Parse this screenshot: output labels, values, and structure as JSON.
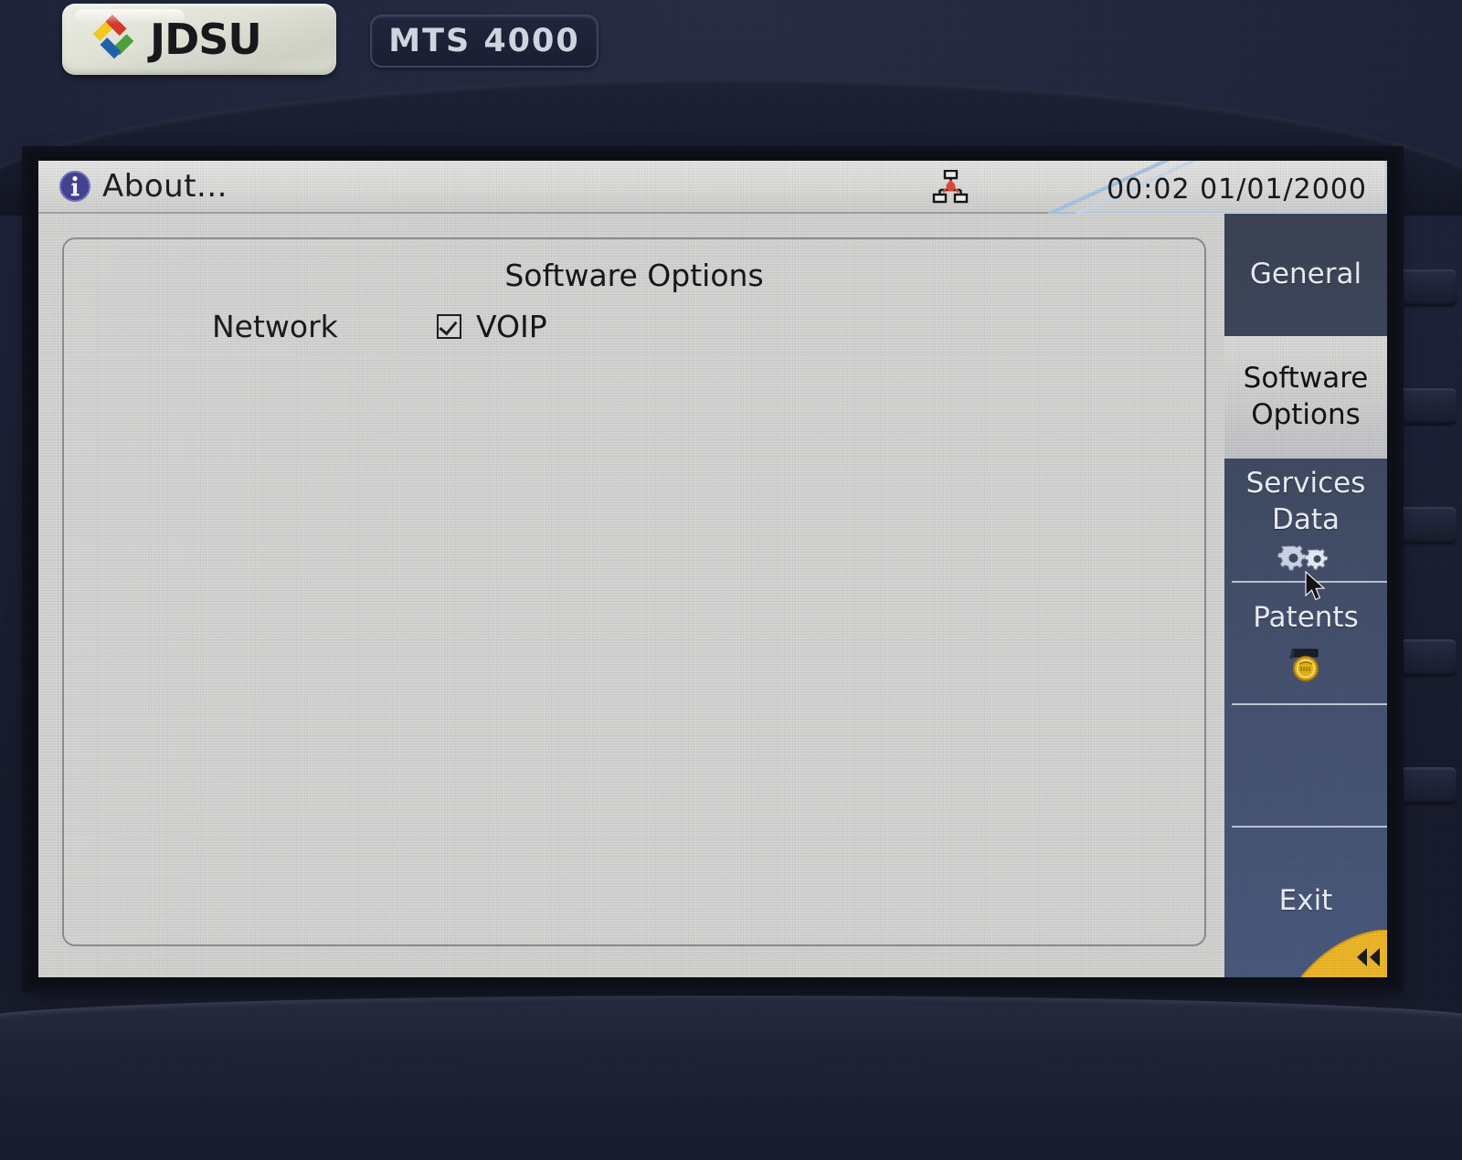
{
  "device": {
    "brand": "JDSU",
    "model": "MTS 4000",
    "logo_icon": "jdsu-diamond-logo",
    "side_keys_count": 5
  },
  "titlebar": {
    "info_icon": "info-circle-icon",
    "title": "About...",
    "network_icon": "network-disconnected-icon",
    "clock": "00:02 01/01/2000"
  },
  "content": {
    "heading": "Software Options",
    "group_label": "Network",
    "options": [
      {
        "label": "VOIP",
        "checked": true,
        "checkbox_icon": "checkbox-checked-icon"
      }
    ]
  },
  "sidebar": {
    "items": [
      {
        "key": "general",
        "label": "General",
        "label2": "",
        "active": false,
        "icon": "",
        "divider": false
      },
      {
        "key": "software-options",
        "label": "Software",
        "label2": "Options",
        "active": true,
        "icon": "",
        "divider": false
      },
      {
        "key": "services-data",
        "label": "Services",
        "label2": "Data",
        "active": false,
        "icon": "gears-icon",
        "divider": false
      },
      {
        "key": "patents",
        "label": "Patents",
        "label2": "",
        "active": false,
        "icon": "patent-seal-icon",
        "divider": true
      },
      {
        "key": "blank",
        "label": "",
        "label2": "",
        "active": false,
        "icon": "",
        "divider": true
      },
      {
        "key": "exit",
        "label": "Exit",
        "label2": "",
        "active": false,
        "icon": "",
        "divider": true
      }
    ],
    "back_button_icon": "double-left-arrow-icon"
  },
  "colors": {
    "screen_bg": "#d6d6d4",
    "titlebar_bg": "#e0e0de",
    "sidebar_top": "#3a4254",
    "sidebar_bottom": "#48587c",
    "active_item_bg": "#d0d0ce",
    "text_dark": "#141417",
    "text_light": "#eef1f7",
    "accent_yellow": "#f0b828",
    "bezel": "#1a1f33",
    "network_alert_red": "#e04b3c"
  }
}
